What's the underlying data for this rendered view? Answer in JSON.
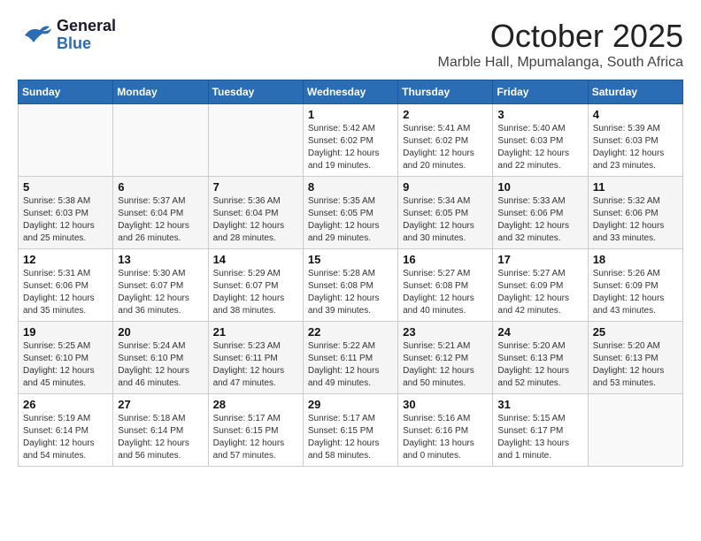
{
  "header": {
    "logo_general": "General",
    "logo_blue": "Blue",
    "month_title": "October 2025",
    "subtitle": "Marble Hall, Mpumalanga, South Africa"
  },
  "weekdays": [
    "Sunday",
    "Monday",
    "Tuesday",
    "Wednesday",
    "Thursday",
    "Friday",
    "Saturday"
  ],
  "weeks": [
    [
      {
        "day": "",
        "info": ""
      },
      {
        "day": "",
        "info": ""
      },
      {
        "day": "",
        "info": ""
      },
      {
        "day": "1",
        "info": "Sunrise: 5:42 AM\nSunset: 6:02 PM\nDaylight: 12 hours\nand 19 minutes."
      },
      {
        "day": "2",
        "info": "Sunrise: 5:41 AM\nSunset: 6:02 PM\nDaylight: 12 hours\nand 20 minutes."
      },
      {
        "day": "3",
        "info": "Sunrise: 5:40 AM\nSunset: 6:03 PM\nDaylight: 12 hours\nand 22 minutes."
      },
      {
        "day": "4",
        "info": "Sunrise: 5:39 AM\nSunset: 6:03 PM\nDaylight: 12 hours\nand 23 minutes."
      }
    ],
    [
      {
        "day": "5",
        "info": "Sunrise: 5:38 AM\nSunset: 6:03 PM\nDaylight: 12 hours\nand 25 minutes."
      },
      {
        "day": "6",
        "info": "Sunrise: 5:37 AM\nSunset: 6:04 PM\nDaylight: 12 hours\nand 26 minutes."
      },
      {
        "day": "7",
        "info": "Sunrise: 5:36 AM\nSunset: 6:04 PM\nDaylight: 12 hours\nand 28 minutes."
      },
      {
        "day": "8",
        "info": "Sunrise: 5:35 AM\nSunset: 6:05 PM\nDaylight: 12 hours\nand 29 minutes."
      },
      {
        "day": "9",
        "info": "Sunrise: 5:34 AM\nSunset: 6:05 PM\nDaylight: 12 hours\nand 30 minutes."
      },
      {
        "day": "10",
        "info": "Sunrise: 5:33 AM\nSunset: 6:06 PM\nDaylight: 12 hours\nand 32 minutes."
      },
      {
        "day": "11",
        "info": "Sunrise: 5:32 AM\nSunset: 6:06 PM\nDaylight: 12 hours\nand 33 minutes."
      }
    ],
    [
      {
        "day": "12",
        "info": "Sunrise: 5:31 AM\nSunset: 6:06 PM\nDaylight: 12 hours\nand 35 minutes."
      },
      {
        "day": "13",
        "info": "Sunrise: 5:30 AM\nSunset: 6:07 PM\nDaylight: 12 hours\nand 36 minutes."
      },
      {
        "day": "14",
        "info": "Sunrise: 5:29 AM\nSunset: 6:07 PM\nDaylight: 12 hours\nand 38 minutes."
      },
      {
        "day": "15",
        "info": "Sunrise: 5:28 AM\nSunset: 6:08 PM\nDaylight: 12 hours\nand 39 minutes."
      },
      {
        "day": "16",
        "info": "Sunrise: 5:27 AM\nSunset: 6:08 PM\nDaylight: 12 hours\nand 40 minutes."
      },
      {
        "day": "17",
        "info": "Sunrise: 5:27 AM\nSunset: 6:09 PM\nDaylight: 12 hours\nand 42 minutes."
      },
      {
        "day": "18",
        "info": "Sunrise: 5:26 AM\nSunset: 6:09 PM\nDaylight: 12 hours\nand 43 minutes."
      }
    ],
    [
      {
        "day": "19",
        "info": "Sunrise: 5:25 AM\nSunset: 6:10 PM\nDaylight: 12 hours\nand 45 minutes."
      },
      {
        "day": "20",
        "info": "Sunrise: 5:24 AM\nSunset: 6:10 PM\nDaylight: 12 hours\nand 46 minutes."
      },
      {
        "day": "21",
        "info": "Sunrise: 5:23 AM\nSunset: 6:11 PM\nDaylight: 12 hours\nand 47 minutes."
      },
      {
        "day": "22",
        "info": "Sunrise: 5:22 AM\nSunset: 6:11 PM\nDaylight: 12 hours\nand 49 minutes."
      },
      {
        "day": "23",
        "info": "Sunrise: 5:21 AM\nSunset: 6:12 PM\nDaylight: 12 hours\nand 50 minutes."
      },
      {
        "day": "24",
        "info": "Sunrise: 5:20 AM\nSunset: 6:13 PM\nDaylight: 12 hours\nand 52 minutes."
      },
      {
        "day": "25",
        "info": "Sunrise: 5:20 AM\nSunset: 6:13 PM\nDaylight: 12 hours\nand 53 minutes."
      }
    ],
    [
      {
        "day": "26",
        "info": "Sunrise: 5:19 AM\nSunset: 6:14 PM\nDaylight: 12 hours\nand 54 minutes."
      },
      {
        "day": "27",
        "info": "Sunrise: 5:18 AM\nSunset: 6:14 PM\nDaylight: 12 hours\nand 56 minutes."
      },
      {
        "day": "28",
        "info": "Sunrise: 5:17 AM\nSunset: 6:15 PM\nDaylight: 12 hours\nand 57 minutes."
      },
      {
        "day": "29",
        "info": "Sunrise: 5:17 AM\nSunset: 6:15 PM\nDaylight: 12 hours\nand 58 minutes."
      },
      {
        "day": "30",
        "info": "Sunrise: 5:16 AM\nSunset: 6:16 PM\nDaylight: 13 hours\nand 0 minutes."
      },
      {
        "day": "31",
        "info": "Sunrise: 5:15 AM\nSunset: 6:17 PM\nDaylight: 13 hours\nand 1 minute."
      },
      {
        "day": "",
        "info": ""
      }
    ]
  ]
}
